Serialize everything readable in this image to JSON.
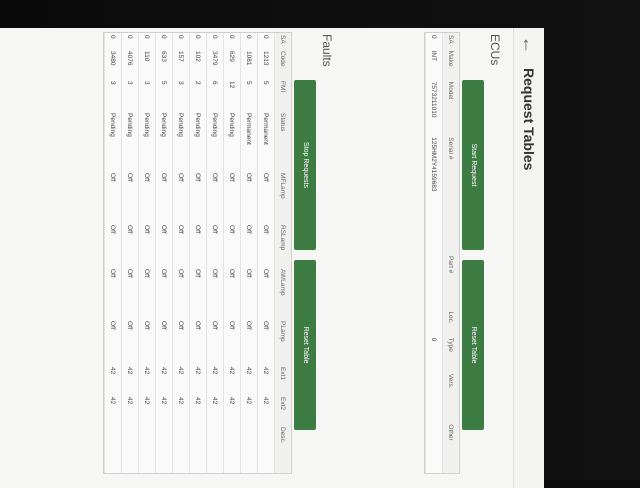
{
  "header": {
    "back_icon": "arrow-left-icon",
    "title": "Request Tables"
  },
  "ecus": {
    "title": "ECUs",
    "buttons": {
      "start": "Start Request",
      "reset": "Reset Table"
    },
    "columns": [
      "SA",
      "Make",
      "Model",
      "Serial #",
      "Part #",
      "Loc.",
      "Type",
      "Vers.",
      "Other"
    ],
    "rows": [
      [
        "0",
        "INT",
        "7573211010",
        "125HM2Y4159683",
        "",
        "",
        "0",
        "",
        ""
      ]
    ]
  },
  "faults": {
    "title": "Faults",
    "buttons": {
      "stop": "Stop Requests",
      "reset": "Reset Table"
    },
    "columns": [
      "SA",
      "Code",
      "FMI",
      "Status",
      "MFLamp",
      "RSLamp",
      "AWLamp",
      "PLamp",
      "Ext1",
      "Ext2",
      "Desc."
    ],
    "rows": [
      [
        "0",
        "1213",
        "5",
        "Permanent",
        "Off",
        "Off",
        "Off",
        "Off",
        "42",
        "42",
        ""
      ],
      [
        "0",
        "1081",
        "5",
        "Permanent",
        "Off",
        "Off",
        "Off",
        "Off",
        "42",
        "42",
        ""
      ],
      [
        "0",
        "629",
        "12",
        "Pending",
        "Off",
        "Off",
        "Off",
        "Off",
        "42",
        "42",
        ""
      ],
      [
        "0",
        "3479",
        "6",
        "Pending",
        "Off",
        "Off",
        "Off",
        "Off",
        "42",
        "42",
        ""
      ],
      [
        "0",
        "102",
        "2",
        "Pending",
        "Off",
        "Off",
        "Off",
        "Off",
        "42",
        "42",
        ""
      ],
      [
        "0",
        "157",
        "3",
        "Pending",
        "Off",
        "Off",
        "Off",
        "Off",
        "42",
        "42",
        ""
      ],
      [
        "0",
        "633",
        "5",
        "Pending",
        "Off",
        "Off",
        "Off",
        "Off",
        "42",
        "42",
        ""
      ],
      [
        "0",
        "110",
        "3",
        "Pending",
        "Off",
        "Off",
        "Off",
        "Off",
        "42",
        "42",
        ""
      ],
      [
        "0",
        "4076",
        "3",
        "Pending",
        "Off",
        "Off",
        "Off",
        "Off",
        "42",
        "42",
        ""
      ],
      [
        "0",
        "3480",
        "3",
        "Pending",
        "Off",
        "Off",
        "Off",
        "Off",
        "42",
        "42",
        ""
      ]
    ]
  },
  "colors": {
    "accent": "#3d7d44",
    "screen": "#f6f6f4"
  }
}
